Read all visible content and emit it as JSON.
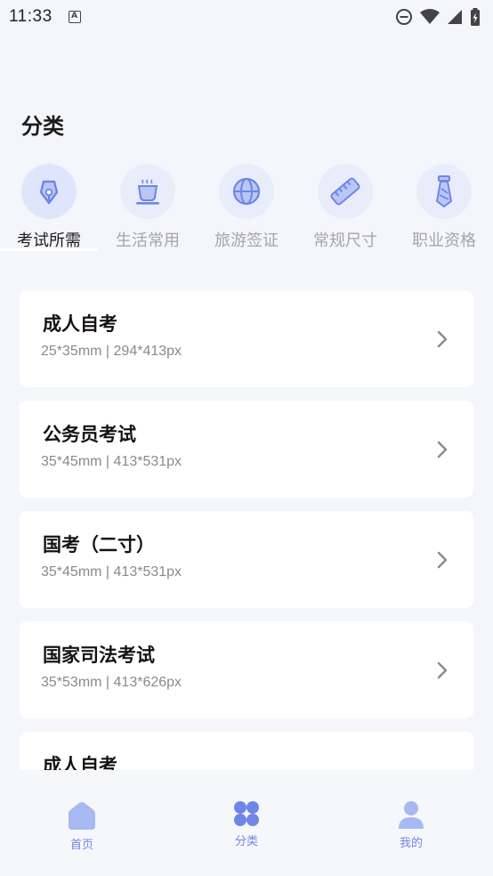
{
  "status": {
    "time": "11:33",
    "notif_letter": "A"
  },
  "page": {
    "title": "分类"
  },
  "categories": [
    {
      "label": "考试所需",
      "icon": "pen-nib-icon",
      "active": true
    },
    {
      "label": "生活常用",
      "icon": "coffee-cup-icon",
      "active": false
    },
    {
      "label": "旅游签证",
      "icon": "globe-icon",
      "active": false
    },
    {
      "label": "常规尺寸",
      "icon": "ruler-icon",
      "active": false
    },
    {
      "label": "职业资格",
      "icon": "tie-icon",
      "active": false
    }
  ],
  "items": [
    {
      "title": "成人自考",
      "spec": "25*35mm | 294*413px"
    },
    {
      "title": "公务员考试",
      "spec": "35*45mm | 413*531px"
    },
    {
      "title": "国考（二寸）",
      "spec": "35*45mm | 413*531px"
    },
    {
      "title": "国家司法考试",
      "spec": "35*53mm | 413*626px"
    },
    {
      "title": "成人自考",
      "spec": ""
    }
  ],
  "tabbar": [
    {
      "label": "首页",
      "icon": "home-icon"
    },
    {
      "label": "分类",
      "icon": "category-grid-icon"
    },
    {
      "label": "我的",
      "icon": "user-icon"
    }
  ],
  "colors": {
    "accent": "#7b93ef",
    "icon_bg": "#e9edfb",
    "page_bg": "#f5f6fb",
    "card_bg": "#ffffff"
  }
}
